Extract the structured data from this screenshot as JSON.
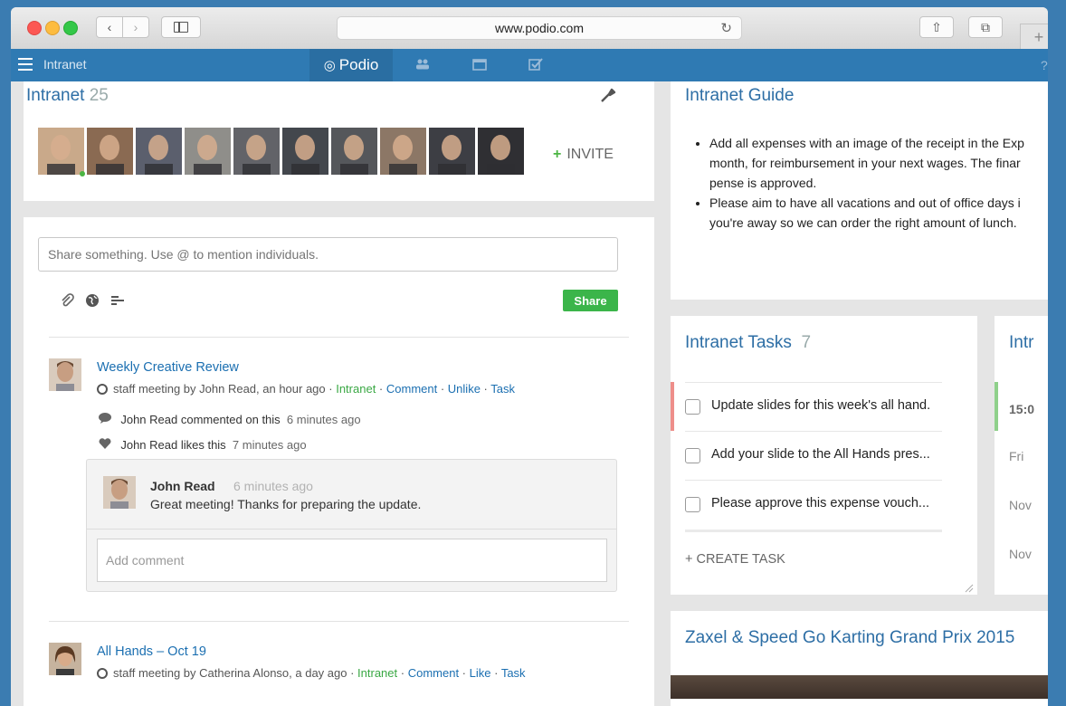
{
  "browser": {
    "url": "www.podio.com",
    "new_tab": "+"
  },
  "nav": {
    "workspace": "Intranet",
    "logo_text": "Podio",
    "icons": [
      "contacts-icon",
      "calendar-icon",
      "tasks-icon"
    ]
  },
  "workspace": {
    "title": "Intranet",
    "member_count": "25",
    "invite_label": "INVITE",
    "avatar_colors": [
      "#c9a98a",
      "#8a6a52",
      "#5b5f6d",
      "#8f8e8a",
      "#626368",
      "#43474d",
      "#55575b",
      "#8c7766",
      "#3d3e44",
      "#2f2f33"
    ]
  },
  "share": {
    "placeholder": "Share something. Use @ to mention individuals.",
    "button": "Share"
  },
  "posts": [
    {
      "title": "Weekly Creative Review",
      "meta_prefix": "staff meeting by John Read, an hour ago",
      "workspace": "Intranet",
      "actions": [
        "Comment",
        "Unlike",
        "Task"
      ],
      "activity": [
        {
          "text": "John Read commented on this",
          "time": "6 minutes ago"
        },
        {
          "text": "John Read likes this",
          "time": "7 minutes ago"
        }
      ],
      "comment": {
        "author": "John Read",
        "time": "6 minutes ago",
        "text": "Great meeting! Thanks for preparing the update."
      },
      "add_comment_placeholder": "Add comment"
    },
    {
      "title": "All Hands – Oct 19",
      "meta_prefix": "staff meeting by Catherina Alonso, a day ago",
      "workspace": "Intranet",
      "actions": [
        "Comment",
        "Like",
        "Task"
      ]
    }
  ],
  "guide": {
    "title": "Intranet Guide",
    "items": [
      "Add all expenses with an image of the receipt in the Exp month, for reimbursement in your next wages. The finar pense is approved.",
      "Please aim to have all vacations and out of office days i you're away so we can order the right amount of lunch."
    ]
  },
  "tasks": {
    "title": "Intranet Tasks",
    "count": "7",
    "items": [
      "Update slides for this week's all hand.",
      "Add your slide to the All Hands pres...",
      "Please approve this expense vouch..."
    ],
    "create_label": "+ CREATE TASK"
  },
  "calendar_partial": {
    "title": "Intr",
    "values": [
      "15:0",
      "Fri",
      "Nov",
      "Nov"
    ]
  },
  "karting": {
    "title": "Zaxel & Speed Go Karting Grand Prix 2015"
  }
}
